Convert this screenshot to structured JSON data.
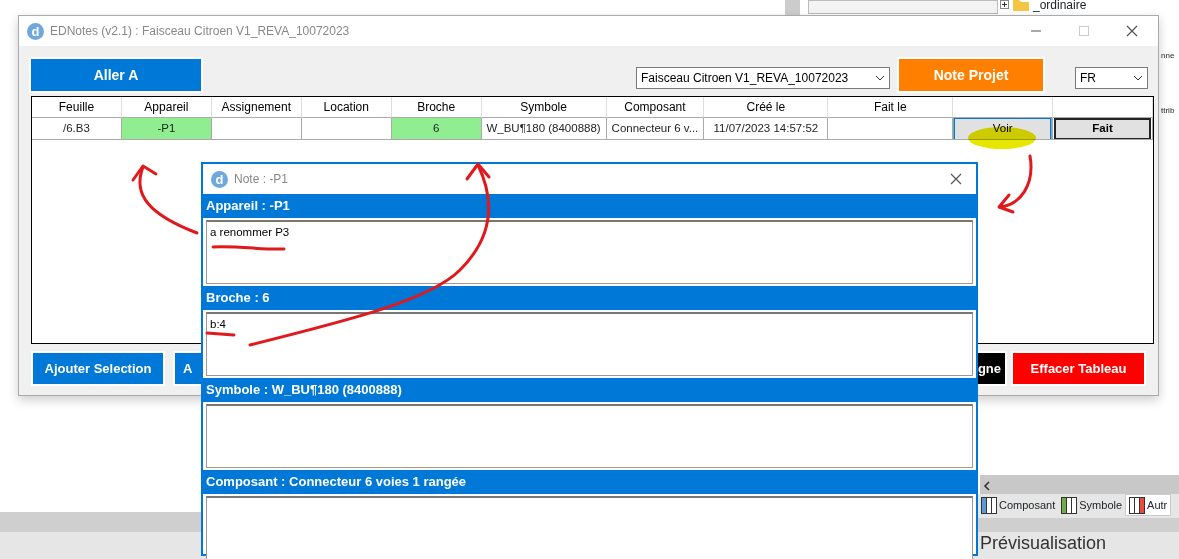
{
  "background_app": {
    "tree_items": [
      "_ordinaire"
    ],
    "side_labels": [
      "nne",
      "ttrib"
    ],
    "tabs": [
      {
        "label": "Composant",
        "color": "#5b9bd5",
        "selected": false
      },
      {
        "label": "Symbole",
        "color": "#70ad47",
        "selected": false
      },
      {
        "label": "Autr",
        "color": "#e74c3c",
        "selected": true
      }
    ],
    "panel_title": "Prévisualisation"
  },
  "main_window": {
    "logo": "d",
    "title": "EDNotes (v2.1) : Faisceau Citroen V1_REVA_10072023",
    "goto_button": "Aller A",
    "project_select": {
      "value": "Faisceau Citroen V1_REVA_10072023"
    },
    "note_project_button": "Note Projet",
    "language_select": {
      "value": "FR"
    },
    "table": {
      "columns": [
        "Feuille",
        "Appareil",
        "Assignement",
        "Location",
        "Broche",
        "Symbole",
        "Composant",
        "Créé le",
        "Fait le"
      ],
      "rows": [
        {
          "cells": [
            {
              "text": "/6.B3",
              "highlighted": false
            },
            {
              "text": "-P1",
              "highlighted": true
            },
            {
              "text": "",
              "highlighted": false
            },
            {
              "text": "",
              "highlighted": false
            },
            {
              "text": "6",
              "highlighted": true
            },
            {
              "text": "W_BU¶180 (8400888)",
              "highlighted": false
            },
            {
              "text": "Connecteur 6 v...",
              "highlighted": false
            },
            {
              "text": "11/07/2023 14:57:52",
              "highlighted": false
            },
            {
              "text": "",
              "highlighted": false
            }
          ],
          "view_button": {
            "label": "Voir",
            "focused": true
          },
          "done_button": "Fait"
        }
      ]
    },
    "bottom_buttons": [
      {
        "label": "Ajouter Selection",
        "kind": "primary"
      },
      {
        "label": "A",
        "kind": "primary"
      },
      {
        "label": "gne",
        "kind": "dark"
      },
      {
        "label": "Effacer Tableau",
        "kind": "danger"
      }
    ]
  },
  "note_window": {
    "logo": "d",
    "title": "Note : -P1",
    "sections": [
      {
        "heading": "Appareil : -P1",
        "text": "a renommer P3"
      },
      {
        "heading": "Broche : 6",
        "text": "b:4"
      },
      {
        "heading": "Symbole : W_BU¶180 (8400888)"
      },
      {
        "heading": "Composant : Connecteur 6 voies 1 rangée"
      }
    ]
  }
}
